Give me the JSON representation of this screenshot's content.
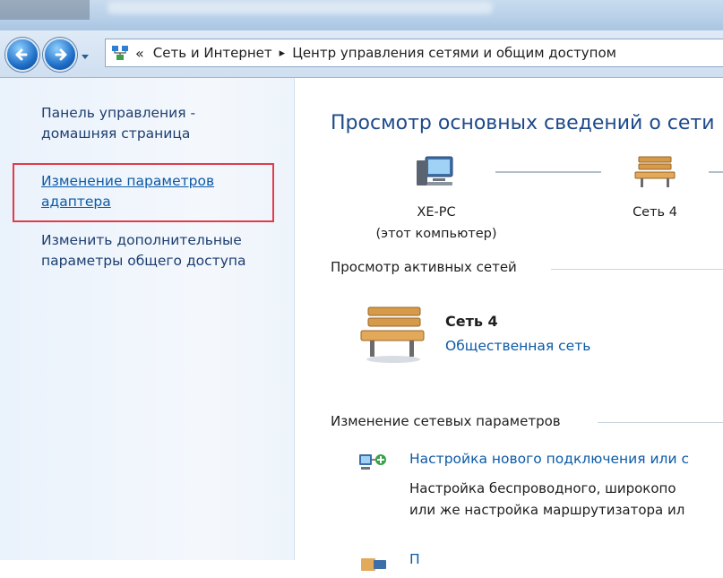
{
  "breadcrumb": {
    "back": "«",
    "item1": "Сеть и Интернет",
    "separator": "▸",
    "item2": "Центр управления сетями и общим доступом"
  },
  "sidebar": {
    "home_line1": "Панель управления -",
    "home_line2": "домашняя страница",
    "adapter_line1": "Изменение параметров",
    "adapter_line2": "адаптера",
    "advanced_line1": "Изменить дополнительные",
    "advanced_line2": "параметры общего доступа"
  },
  "main": {
    "title": "Просмотр основных сведений о сети",
    "map": {
      "computer_name": "XE-PC",
      "computer_sub": "(этот компьютер)",
      "network_name": "Сеть  4"
    },
    "active_networks": {
      "heading": "Просмотр активных сетей",
      "network_name": "Сеть  4",
      "network_type": "Общественная сеть"
    },
    "change_settings": {
      "heading": "Изменение сетевых параметров",
      "task1_link": "Настройка нового подключения или с",
      "task1_desc1": "Настройка беспроводного, широкопо",
      "task1_desc2": "или же настройка маршрутизатора ил",
      "task2_link": "П"
    }
  },
  "colors": {
    "link": "#0b5aa6",
    "title": "#1e4a8a",
    "highlight": "#e23b4a"
  }
}
